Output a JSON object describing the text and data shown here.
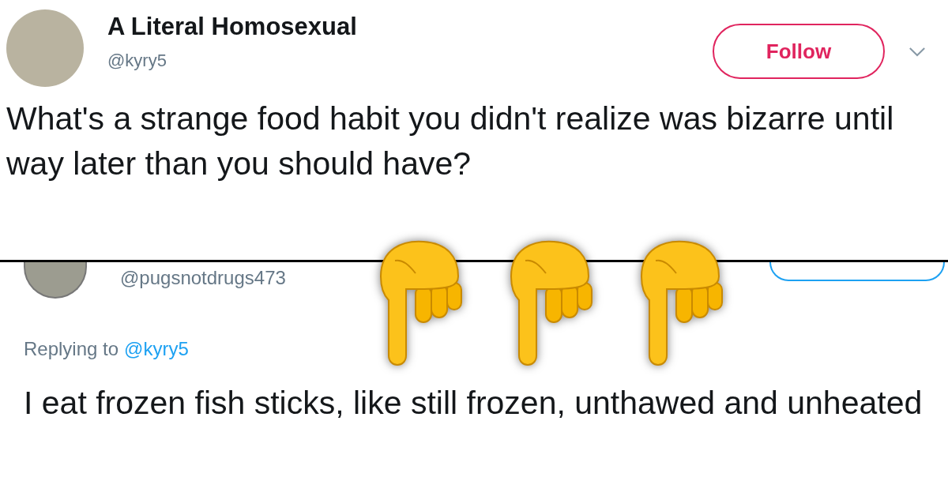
{
  "top_tweet": {
    "author_name": "A Literal Homosexual",
    "handle": "@kyry5",
    "follow_button": "Follow",
    "text": "What's a strange food habit you didn't realize was bizarre until way later than you should have?"
  },
  "reply_tweet": {
    "handle": "@pugsnotdrugs473",
    "replying_prefix": "Replying to",
    "replying_to": "@kyry5",
    "text": "I eat frozen fish sticks, like still frozen, unthawed and unheated"
  }
}
